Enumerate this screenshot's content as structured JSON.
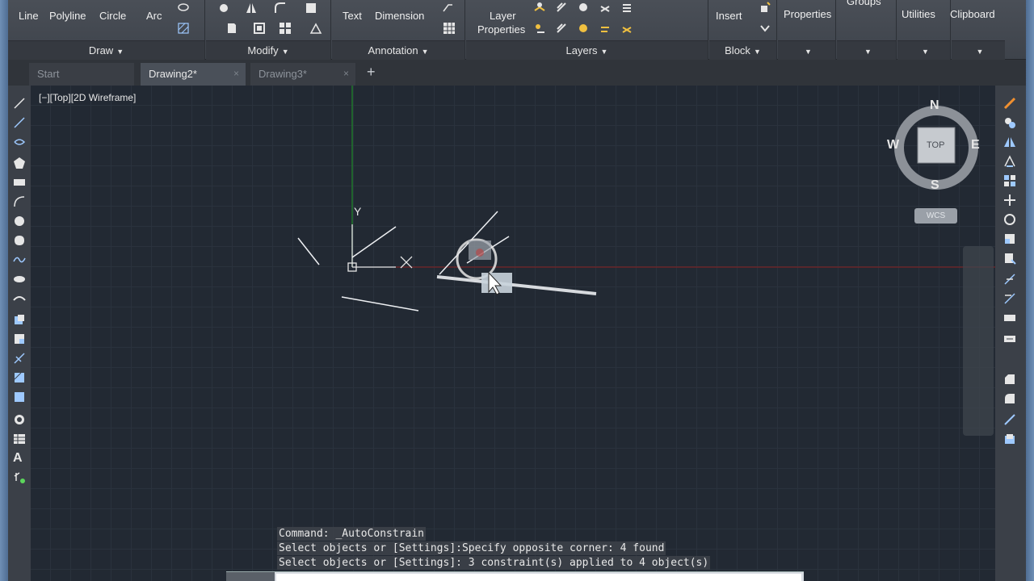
{
  "ribbon": {
    "draw": {
      "title": "Draw",
      "line": "Line",
      "polyline": "Polyline",
      "circle": "Circle",
      "arc": "Arc"
    },
    "modify": {
      "title": "Modify"
    },
    "annotation": {
      "title": "Annotation",
      "text": "Text",
      "dimension": "Dimension"
    },
    "layers": {
      "title": "Layers",
      "layer_properties_1": "Layer",
      "layer_properties_2": "Properties"
    },
    "block": {
      "title": "Block",
      "insert": "Insert"
    },
    "properties": {
      "title": "Properties"
    },
    "groups": {
      "title": "Groups"
    },
    "utilities": {
      "title": "Utilities"
    },
    "clipboard": {
      "title": "Clipboard"
    }
  },
  "tabs": [
    {
      "label": "Start"
    },
    {
      "label": "Drawing2*",
      "close": "×"
    },
    {
      "label": "Drawing3*",
      "close": "×"
    }
  ],
  "viewport": {
    "label": "[−][Top][2D Wireframe]",
    "ucs_y": "Y",
    "viewcube": {
      "n": "N",
      "s": "S",
      "e": "E",
      "w": "W",
      "face": "TOP"
    },
    "wcs": "WCS"
  },
  "command": {
    "history": [
      "Command: _AutoConstrain",
      "Select objects or [Settings]:Specify opposite corner: 4 found",
      "Select objects or [Settings]: 3 constraint(s) applied to 4 object(s)"
    ]
  },
  "colors": {
    "accent": "#ffffff",
    "x_axis": "#b02020",
    "y_axis": "#1f8a2a",
    "background": "#222933"
  }
}
